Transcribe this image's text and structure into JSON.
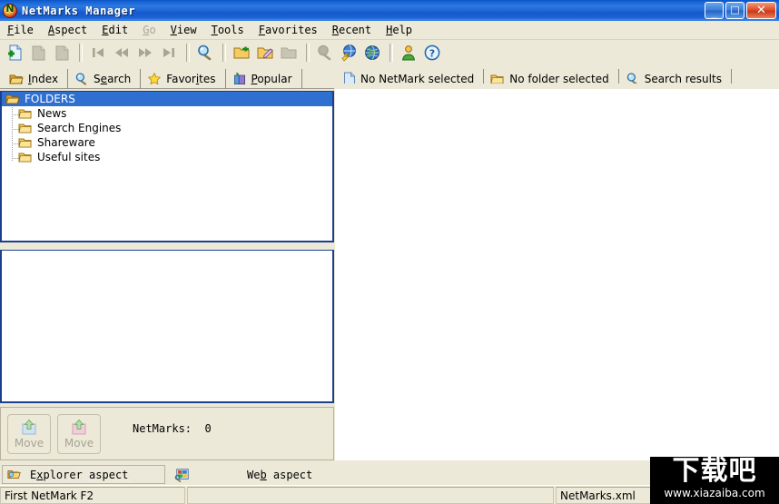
{
  "window": {
    "title": "NetMarks Manager",
    "app_icon": "netmarks-logo-icon",
    "minimize_label": "_",
    "maximize_label": "□",
    "close_label": "✕"
  },
  "menubar": {
    "items": [
      {
        "label": "File",
        "accel": "F",
        "disabled": false
      },
      {
        "label": "Aspect",
        "accel": "A",
        "disabled": false
      },
      {
        "label": "Edit",
        "accel": "E",
        "disabled": false
      },
      {
        "label": "Go",
        "accel": "G",
        "disabled": true
      },
      {
        "label": "View",
        "accel": "V",
        "disabled": false
      },
      {
        "label": "Tools",
        "accel": "T",
        "disabled": false
      },
      {
        "label": "Favorites",
        "accel": "F",
        "disabled": false
      },
      {
        "label": "Recent",
        "accel": "R",
        "disabled": false
      },
      {
        "label": "Help",
        "accel": "H",
        "disabled": false
      }
    ]
  },
  "toolbar": {
    "buttons": [
      {
        "name": "new-netmark-icon",
        "enabled": true
      },
      {
        "name": "cut-netmark-icon",
        "enabled": false
      },
      {
        "name": "copy-netmark-icon",
        "enabled": false
      },
      {
        "name": "separator",
        "enabled": false
      },
      {
        "name": "first-record-icon",
        "enabled": false
      },
      {
        "name": "previous-record-icon",
        "enabled": false
      },
      {
        "name": "next-record-icon",
        "enabled": false
      },
      {
        "name": "last-record-icon",
        "enabled": false
      },
      {
        "name": "separator",
        "enabled": false
      },
      {
        "name": "search-icon",
        "enabled": true
      },
      {
        "name": "separator",
        "enabled": false
      },
      {
        "name": "new-folder-icon",
        "enabled": true
      },
      {
        "name": "edit-folder-icon",
        "enabled": true
      },
      {
        "name": "delete-folder-icon",
        "enabled": false
      },
      {
        "name": "separator",
        "enabled": false
      },
      {
        "name": "find-icon",
        "enabled": false
      },
      {
        "name": "import-web-icon",
        "enabled": true
      },
      {
        "name": "globe-icon",
        "enabled": true
      },
      {
        "name": "separator",
        "enabled": false
      },
      {
        "name": "user-icon",
        "enabled": true
      },
      {
        "name": "help-icon",
        "enabled": true
      }
    ]
  },
  "left_tabs": [
    {
      "label": "Index",
      "accel": "I",
      "icon": "folder-open-icon",
      "selected": true
    },
    {
      "label": "Search",
      "accel": "e",
      "icon": "magnifier-icon",
      "selected": false
    },
    {
      "label": "Favorites",
      "accel": "i",
      "icon": "star-icon",
      "selected": false
    },
    {
      "label": "Popular",
      "accel": "P",
      "icon": "book-icon",
      "selected": false
    }
  ],
  "right_tabs": [
    {
      "label": "No NetMark selected",
      "icon": "document-icon",
      "selected": true
    },
    {
      "label": "No folder selected",
      "icon": "folder-icon",
      "selected": false
    },
    {
      "label": "Search results",
      "icon": "magnifier-icon",
      "selected": false
    }
  ],
  "tree": {
    "root": {
      "label": "FOLDERS",
      "icon": "folder-open-icon",
      "selected": true
    },
    "children": [
      {
        "label": "News",
        "icon": "folder-icon"
      },
      {
        "label": "Search Engines",
        "icon": "folder-icon"
      },
      {
        "label": "Shareware",
        "icon": "folder-icon"
      },
      {
        "label": "Useful sites",
        "icon": "folder-icon"
      }
    ]
  },
  "bottom_panel": {
    "move_up_button": {
      "label": "Move",
      "icon": "move-up-icon",
      "enabled": false
    },
    "move_down_button": {
      "label": "Move",
      "icon": "move-down-icon",
      "enabled": false
    },
    "netmarks_count_label": "NetMarks:  0"
  },
  "aspect_bar": {
    "explorer": {
      "label": "Explorer aspect",
      "accel": "x",
      "icon": "explorer-aspect-icon",
      "active": true
    },
    "web": {
      "label": "Web aspect",
      "accel": "b",
      "icon": "web-aspect-icon",
      "active": false
    }
  },
  "statusbar": {
    "cells": [
      "First NetMark  F2",
      "",
      "NetMarks.xml",
      ""
    ]
  },
  "watermark": {
    "text_cn": "下载吧",
    "url": "www.xiazaiba.com"
  },
  "colors": {
    "title_blue": "#1761d4",
    "face": "#ece9d8",
    "panel_border": "#1b3f8f",
    "selection_blue": "#2f6fd0",
    "folder_yellow": "#f0bf4e",
    "white": "#ffffff"
  }
}
